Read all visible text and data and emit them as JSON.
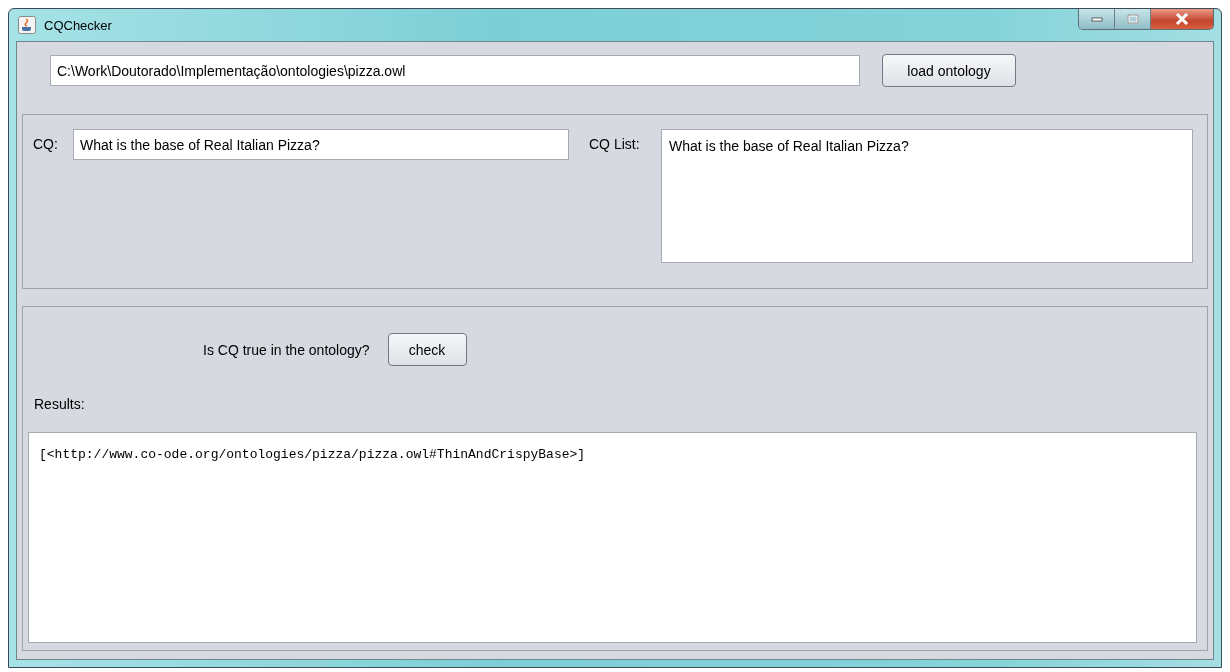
{
  "window": {
    "title": "CQChecker"
  },
  "ontology_path": {
    "value": "C:\\Work\\Doutorado\\Implementação\\ontologies\\pizza.owl"
  },
  "load_button": "load ontology",
  "cq": {
    "label": "CQ:",
    "value": "What is the base of Real Italian Pizza?"
  },
  "cq_list": {
    "label": "CQ List:",
    "items": [
      "What is the base of Real Italian Pizza?"
    ]
  },
  "check": {
    "prompt": "Is CQ true in the ontology?",
    "button": "check"
  },
  "results": {
    "label": "Results:",
    "lines": [
      "[<http://www.co-ode.org/ontologies/pizza/pizza.owl#ThinAndCrispyBase>]"
    ]
  }
}
